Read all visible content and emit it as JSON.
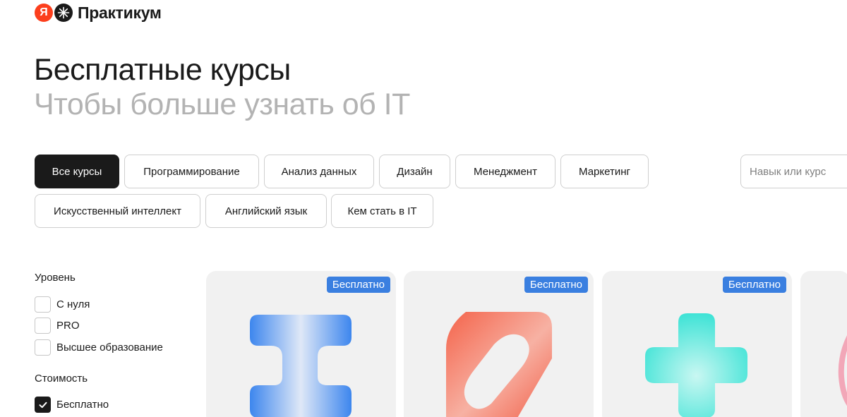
{
  "brand": {
    "ya_letter": "Я",
    "name": "Практикум"
  },
  "header": {
    "title": "Бесплатные курсы",
    "subtitle": "Чтобы больше узнать об IT"
  },
  "categories": [
    {
      "label": "Все курсы",
      "active": true
    },
    {
      "label": "Программирование"
    },
    {
      "label": "Анализ данных"
    },
    {
      "label": "Дизайн"
    },
    {
      "label": "Менеджмент"
    },
    {
      "label": "Маркетинг"
    },
    {
      "label": "Искусственный интеллект"
    },
    {
      "label": "Английский язык"
    },
    {
      "label": "Кем стать в IT"
    }
  ],
  "search": {
    "placeholder": "Навык или курс",
    "value": ""
  },
  "filters": {
    "level": {
      "heading": "Уровень",
      "options": [
        {
          "label": "С нуля",
          "checked": false
        },
        {
          "label": "PRO",
          "checked": false
        },
        {
          "label": "Высшее образование",
          "checked": false
        }
      ]
    },
    "cost": {
      "heading": "Стоимость",
      "options": [
        {
          "label": "Бесплатно",
          "checked": true
        }
      ]
    }
  },
  "cards": [
    {
      "badge": "Бесплатно",
      "icon": "blue-i-beam-icon",
      "color": "#4a90f0"
    },
    {
      "badge": "Бесплатно",
      "icon": "red-slash-shape-icon",
      "color": "#f2614a"
    },
    {
      "badge": "Бесплатно",
      "icon": "turquoise-plus-icon",
      "color": "#3fe3d6"
    }
  ],
  "colors": {
    "accent_badge": "#3a7fe0",
    "brand_red": "#fc3f1d",
    "active_chip": "#1a1a1a"
  }
}
